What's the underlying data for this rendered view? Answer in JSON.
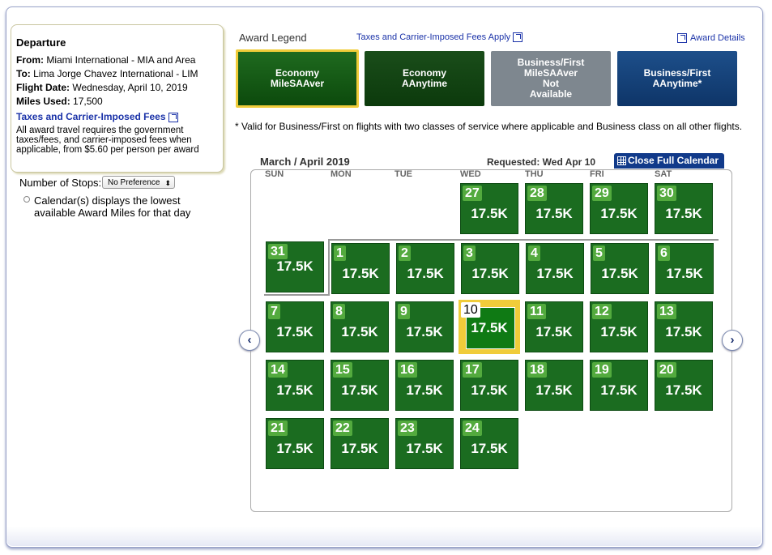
{
  "departure": {
    "heading": "Departure",
    "from_label": "From:",
    "from_value": "Miami International - MIA and Area",
    "to_label": "To:",
    "to_value": "Lima Jorge Chavez International - LIM",
    "date_label": "Flight Date:",
    "date_value": "Wednesday, April 10, 2019",
    "miles_label": "Miles Used:",
    "miles_value": "17,500",
    "taxes_link": "Taxes and Carrier-Imposed Fees",
    "note": "All award travel requires the government taxes/fees, and carrier-imposed fees when applicable, from $5.60 per person per award"
  },
  "filters": {
    "stops_label": "Number of Stops:",
    "stops_value": "No Preference",
    "calendar_note": "Calendar(s) displays the lowest available Award Miles for that day"
  },
  "legend": {
    "title": "Award Legend",
    "taxes_link": "Taxes and Carrier-Imposed Fees Apply",
    "details_link": "Award Details",
    "items": [
      {
        "line1": "Economy",
        "line2": "MileSAAver",
        "line3": "",
        "line4": ""
      },
      {
        "line1": "Economy",
        "line2": "AAnytime",
        "line3": "",
        "line4": ""
      },
      {
        "line1": "Business/First",
        "line2": "MileSAAver",
        "line3": "Not",
        "line4": "Available"
      },
      {
        "line1": "Business/First",
        "line2": "AAnytime*",
        "line3": "",
        "line4": ""
      }
    ],
    "valid_note": "* Valid for Business/First on flights with two classes of service where applicable and Business class on all other flights."
  },
  "calendar": {
    "month": "March / April 2019",
    "requested": "Requested: Wed Apr 10",
    "close_button": "Close Full Calendar",
    "days_of_week": [
      "SUN",
      "MON",
      "TUE",
      "WED",
      "THU",
      "FRI",
      "SAT"
    ],
    "week1": [
      {
        "day": "27",
        "miles": "17.5K"
      },
      {
        "day": "28",
        "miles": "17.5K"
      },
      {
        "day": "29",
        "miles": "17.5K"
      },
      {
        "day": "30",
        "miles": "17.5K"
      }
    ],
    "week2": [
      {
        "day": "31",
        "miles": "17.5K"
      },
      {
        "day": "1",
        "miles": "17.5K"
      },
      {
        "day": "2",
        "miles": "17.5K"
      },
      {
        "day": "3",
        "miles": "17.5K"
      },
      {
        "day": "4",
        "miles": "17.5K"
      },
      {
        "day": "5",
        "miles": "17.5K"
      },
      {
        "day": "6",
        "miles": "17.5K"
      }
    ],
    "week3": [
      {
        "day": "7",
        "miles": "17.5K"
      },
      {
        "day": "8",
        "miles": "17.5K"
      },
      {
        "day": "9",
        "miles": "17.5K"
      },
      {
        "day": "10",
        "miles": "17.5K"
      },
      {
        "day": "11",
        "miles": "17.5K"
      },
      {
        "day": "12",
        "miles": "17.5K"
      },
      {
        "day": "13",
        "miles": "17.5K"
      }
    ],
    "week4": [
      {
        "day": "14",
        "miles": "17.5K"
      },
      {
        "day": "15",
        "miles": "17.5K"
      },
      {
        "day": "16",
        "miles": "17.5K"
      },
      {
        "day": "17",
        "miles": "17.5K"
      },
      {
        "day": "18",
        "miles": "17.5K"
      },
      {
        "day": "19",
        "miles": "17.5K"
      },
      {
        "day": "20",
        "miles": "17.5K"
      }
    ],
    "week5": [
      {
        "day": "21",
        "miles": "17.5K"
      },
      {
        "day": "22",
        "miles": "17.5K"
      },
      {
        "day": "23",
        "miles": "17.5K"
      },
      {
        "day": "24",
        "miles": "17.5K"
      }
    ],
    "prev_icon": "chevron-left-icon",
    "next_icon": "chevron-right-icon"
  },
  "colors": {
    "day_green": "#1b6c20",
    "day_number": "#53aa3e",
    "selected_border": "#f0cc3a",
    "link_blue": "#1a32a8",
    "close_button_blue": "#113a8a"
  }
}
